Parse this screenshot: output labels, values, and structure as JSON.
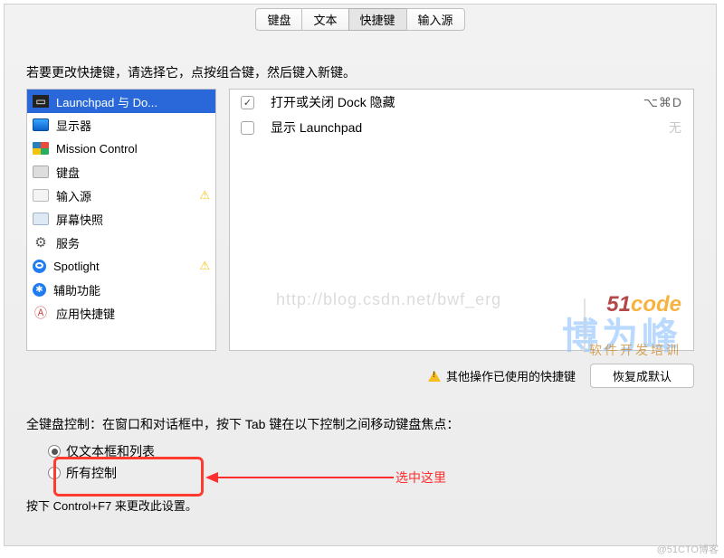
{
  "tabs": [
    {
      "label": "键盘",
      "active": false
    },
    {
      "label": "文本",
      "active": false
    },
    {
      "label": "快捷键",
      "active": true
    },
    {
      "label": "输入源",
      "active": false
    }
  ],
  "instruction": "若要更改快捷键，请选择它，点按组合键，然后键入新键。",
  "categories": [
    {
      "name": "Launchpad 与 Do...",
      "icon": "dock-icon",
      "selected": true,
      "warn": false
    },
    {
      "name": "显示器",
      "icon": "display-icon",
      "selected": false,
      "warn": false
    },
    {
      "name": "Mission Control",
      "icon": "grid-icon",
      "selected": false,
      "warn": false
    },
    {
      "name": "键盘",
      "icon": "keyboard-icon",
      "selected": false,
      "warn": false
    },
    {
      "name": "输入源",
      "icon": "flag-icon",
      "selected": false,
      "warn": true
    },
    {
      "name": "屏幕快照",
      "icon": "snapshot-icon",
      "selected": false,
      "warn": false
    },
    {
      "name": "服务",
      "icon": "gear-icon",
      "selected": false,
      "warn": false
    },
    {
      "name": "Spotlight",
      "icon": "spotlight-icon",
      "selected": false,
      "warn": true
    },
    {
      "name": "辅助功能",
      "icon": "accessibility-icon",
      "selected": false,
      "warn": false
    },
    {
      "name": "应用快捷键",
      "icon": "app-icon",
      "selected": false,
      "warn": false
    }
  ],
  "shortcuts": [
    {
      "label": "打开或关闭 Dock 隐藏",
      "checked": true,
      "keys": "⌥⌘D"
    },
    {
      "label": "显示 Launchpad",
      "checked": false,
      "keys": "无"
    }
  ],
  "conflict_warning": "其他操作已使用的快捷键",
  "reset_button": "恢复成默认",
  "fkc_heading": "全键盘控制：在窗口和对话框中，按下 Tab 键在以下控制之间移动键盘焦点：",
  "radios": [
    {
      "label": "仅文本框和列表",
      "checked": true
    },
    {
      "label": "所有控制",
      "checked": false
    }
  ],
  "annotation": "选中这里",
  "footer_note": "按下 Control+F7 来更改此设置。",
  "watermark_url": "http://blog.csdn.net/bwf_erg",
  "watermark_logo": "博为峰",
  "watermark_code_num": "51",
  "watermark_code_txt": "code",
  "watermark_sub": "软件开发培训",
  "credit": "@51CTO博客"
}
